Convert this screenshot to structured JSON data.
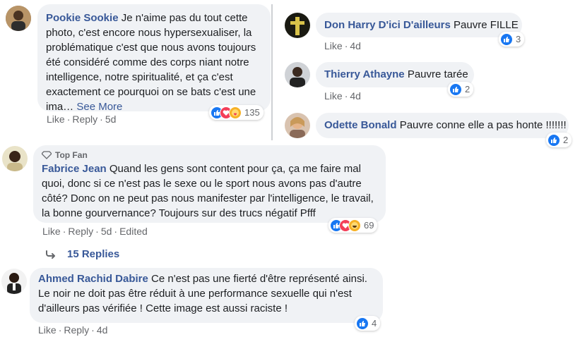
{
  "comments": {
    "pookie": {
      "author": "Pookie Sookie",
      "text": "Je n'aime pas du tout cette photo, c'est encore nous hypersexualiser, la problématique c'est que nous avons toujours été considéré comme des corps niant notre intelligence, notre spiritualité, et ça c'est exactement ce pourquoi on se bats c'est une ima…",
      "see_more": "See More",
      "like": "Like",
      "reply": "Reply",
      "time": "5d",
      "reaction_count": "135",
      "reactions": [
        "like",
        "love",
        "care"
      ]
    },
    "fabrice": {
      "badge": "Top Fan",
      "author": "Fabrice Jean",
      "text": "Quand les gens sont content pour ça, ça me faire mal quoi, donc si ce n'est pas le sexe ou le sport nous avons pas d'autre côté? Donc on ne peut pas nous manifester par l'intelligence, le travail, la bonne gourvernance? Toujours sur des trucs négatif Pfff",
      "like": "Like",
      "reply": "Reply",
      "time": "5d",
      "edited": "Edited",
      "reaction_count": "69",
      "reactions": [
        "like",
        "love",
        "haha"
      ],
      "replies_link": "15 Replies"
    },
    "ahmed": {
      "author": "Ahmed Rachid Dabire",
      "text": "Ce n'est pas une fierté d'être représenté ainsi. Le noir ne doit pas être réduit à une performance sexuelle qui n'est d'ailleurs pas vérifiée ! Cette image est aussi raciste !",
      "like": "Like",
      "reply": "Reply",
      "time": "4d",
      "reaction_count": "4",
      "reactions": [
        "like"
      ]
    },
    "don": {
      "author": "Don Harry D'ici D'ailleurs",
      "text": "Pauvre FILLE",
      "like": "Like",
      "time": "4d",
      "reaction_count": "3",
      "reactions": [
        "like"
      ]
    },
    "thierry": {
      "author": "Thierry Athayne",
      "text": "Pauvre tarée",
      "like": "Like",
      "time": "4d",
      "reaction_count": "2",
      "reactions": [
        "like"
      ]
    },
    "odette": {
      "author": "Odette Bonald",
      "text": "Pauvre conne elle a pas honte !!!!!!!",
      "reaction_count": "2",
      "reactions": [
        "like"
      ]
    }
  },
  "colors": {
    "bubble": "#f0f2f5",
    "author": "#385898",
    "meta": "#65676b",
    "like_blue": "#1877f2",
    "love_red": "#f33e58",
    "care_yellow": "#f7b125"
  }
}
